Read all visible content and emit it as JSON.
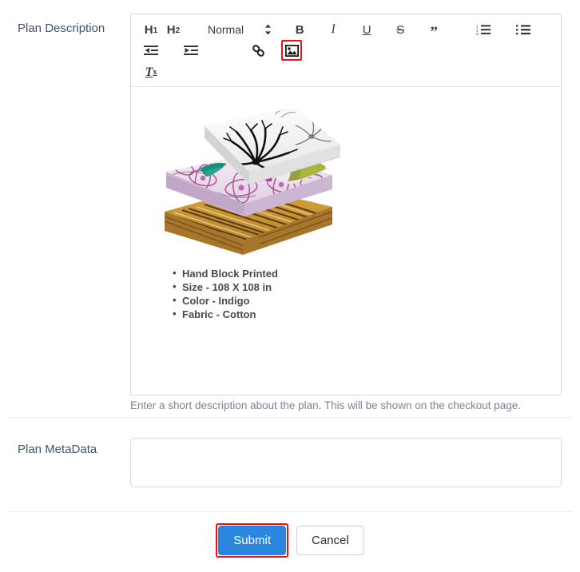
{
  "form": {
    "description_label": "Plan Description",
    "metadata_label": "Plan MetaData",
    "description_help": "Enter a short description about the plan. This will be shown on the checkout page.",
    "metadata_value": "",
    "metadata_placeholder": ""
  },
  "editor": {
    "toolbar": {
      "h1_label": "H",
      "h1_sub": "1",
      "h2_label": "H",
      "h2_sub": "2",
      "style_picker_value": "Normal",
      "bold_label": "B",
      "italic_label": "I",
      "underline_label": "U",
      "strikethrough_label": "S",
      "blockquote_label": "”",
      "clear_format_label": "T",
      "clear_format_sub": "x",
      "buttons": [
        {
          "name": "heading-1-button",
          "label": "H1"
        },
        {
          "name": "heading-2-button",
          "label": "H2"
        },
        {
          "name": "style-picker",
          "label": "Normal"
        },
        {
          "name": "bold-button",
          "label": "B"
        },
        {
          "name": "italic-button",
          "label": "I"
        },
        {
          "name": "underline-button",
          "label": "U"
        },
        {
          "name": "strikethrough-button",
          "label": "S"
        },
        {
          "name": "blockquote-button",
          "label": "Quote"
        },
        {
          "name": "ordered-list-button",
          "label": "Ordered List"
        },
        {
          "name": "bullet-list-button",
          "label": "Bullet List"
        },
        {
          "name": "outdent-button",
          "label": "Outdent"
        },
        {
          "name": "indent-button",
          "label": "Indent"
        },
        {
          "name": "link-button",
          "label": "Link"
        },
        {
          "name": "image-button",
          "label": "Image"
        },
        {
          "name": "clear-format-button",
          "label": "Clear Formatting"
        }
      ]
    },
    "content": {
      "image_alt": "Stack of folded printed bedsheets",
      "bullets": [
        "Hand Block Printed",
        "Size - 108 X 108 in",
        "Color - Indigo",
        "Fabric - Cotton"
      ]
    }
  },
  "actions": {
    "submit_label": "Submit",
    "cancel_label": "Cancel"
  },
  "colors": {
    "primary": "#2a86de",
    "highlight": "#ee1111",
    "label_text": "#43536b",
    "help_text": "#7a8594",
    "content_text": "#4a4a4a",
    "border": "#d8d8d8"
  }
}
